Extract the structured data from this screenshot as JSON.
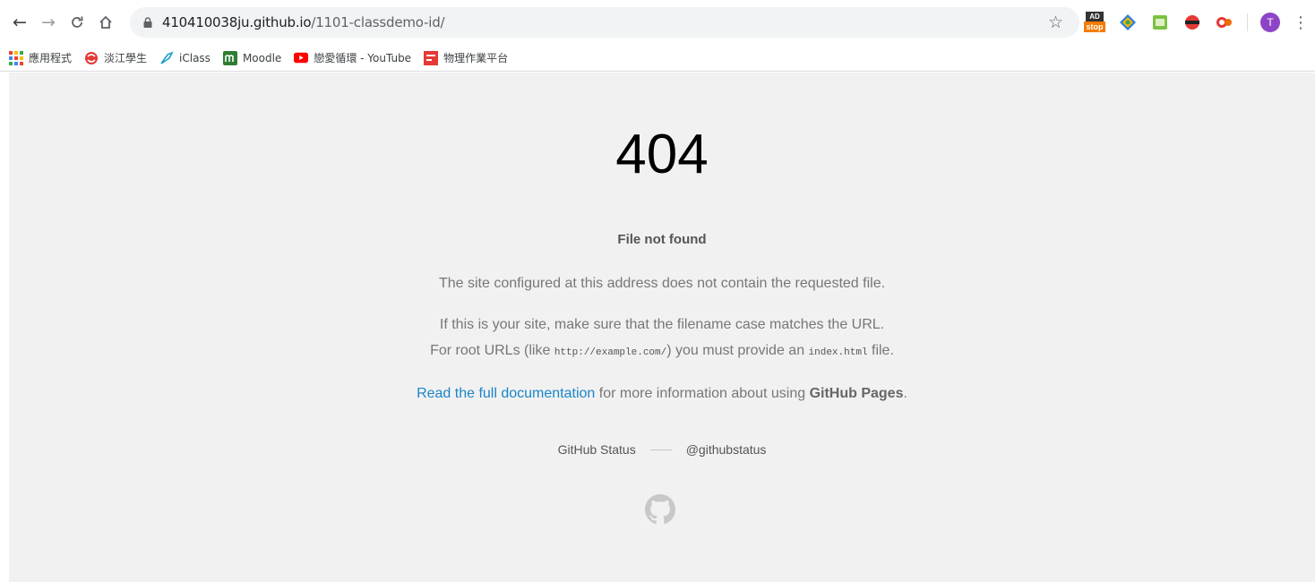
{
  "browser": {
    "url_host": "410410038ju.github.io",
    "url_path": "/1101-classdemo-id/",
    "extensions": {
      "adstop_top": "AD",
      "adstop_bottom": "stop"
    },
    "profile_initial": "T",
    "icons": [
      "back-arrow-icon",
      "forward-arrow-icon",
      "reload-icon",
      "home-icon",
      "lock-icon",
      "star-icon",
      "kebab-menu-icon"
    ]
  },
  "bookmarks": [
    {
      "label": "應用程式",
      "icon": "apps-grid-icon"
    },
    {
      "label": "淡江學生",
      "icon": "tku-logo-icon"
    },
    {
      "label": "iClass",
      "icon": "iclass-icon"
    },
    {
      "label": "Moodle",
      "icon": "moodle-icon"
    },
    {
      "label": "戀愛循環 - YouTube",
      "icon": "youtube-icon"
    },
    {
      "label": "物理作業平台",
      "icon": "physics-platform-icon"
    }
  ],
  "page": {
    "code": "404",
    "title": "File not found",
    "message1": "The site configured at this address does not contain the requested file.",
    "message2": "If this is your site, make sure that the filename case matches the URL.",
    "message3_prefix": "For root URLs (like ",
    "message3_code1": "http://example.com/",
    "message3_middle": ") you must provide an ",
    "message3_code2": "index.html",
    "message3_suffix": " file.",
    "doc_link": "Read the full documentation",
    "doc_middle": " for more information about using ",
    "doc_strong": "GitHub Pages",
    "doc_end": ".",
    "footer_status": "GitHub Status",
    "footer_twitter": "@githubstatus",
    "colors": {
      "link": "#1a85c8",
      "background": "#f1f1f1"
    }
  }
}
